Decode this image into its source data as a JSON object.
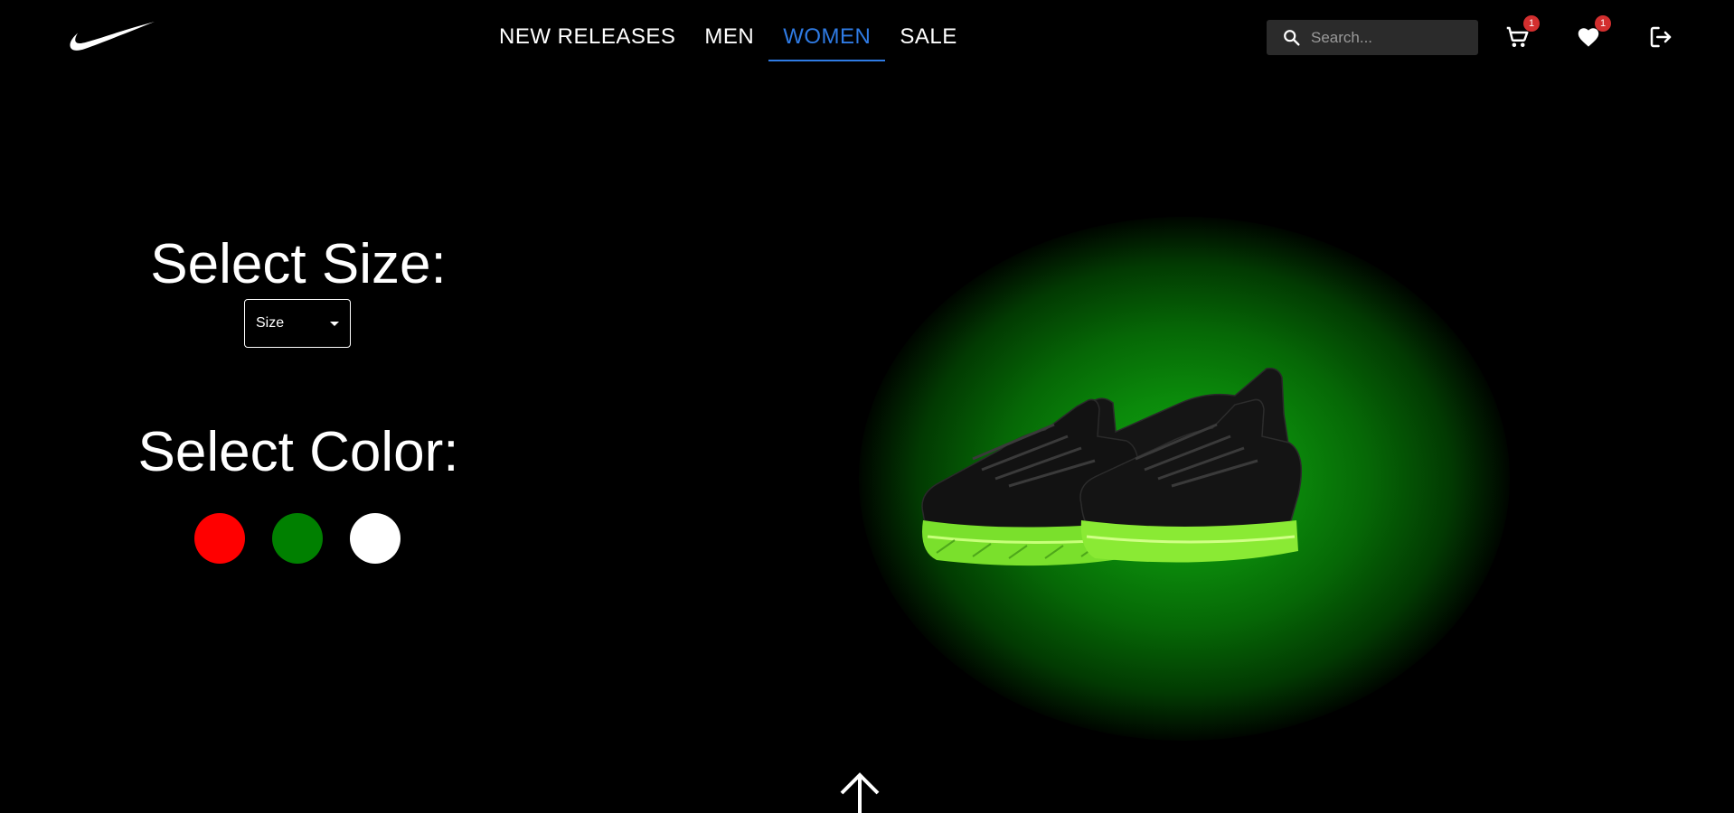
{
  "header": {
    "logo_icon": "nike-swoosh-icon",
    "nav": [
      {
        "label": "NEW RELEASES",
        "active": false
      },
      {
        "label": "MEN",
        "active": false
      },
      {
        "label": "WOMEN",
        "active": true
      },
      {
        "label": "SALE",
        "active": false
      }
    ],
    "search": {
      "placeholder": "Search...",
      "value": "",
      "icon": "search-icon"
    },
    "cart": {
      "icon": "cart-icon",
      "badge": "1"
    },
    "favorites": {
      "icon": "heart-icon",
      "badge": "1"
    },
    "logout": {
      "icon": "logout-icon"
    }
  },
  "selectors": {
    "size_heading": "Select Size:",
    "size_placeholder": "Size",
    "color_heading": "Select Color:",
    "colors": [
      "#ff0000",
      "#008000",
      "#ffffff"
    ]
  },
  "product": {
    "image_icon": "sneaker-image",
    "glow_color": "#0fa30f",
    "sole_color": "#9cff2e"
  },
  "footer": {
    "scroll_icon": "arrow-up-icon"
  },
  "theme": {
    "accent": "#2f7be4",
    "badge": "#d32f2f",
    "background": "#000000"
  }
}
